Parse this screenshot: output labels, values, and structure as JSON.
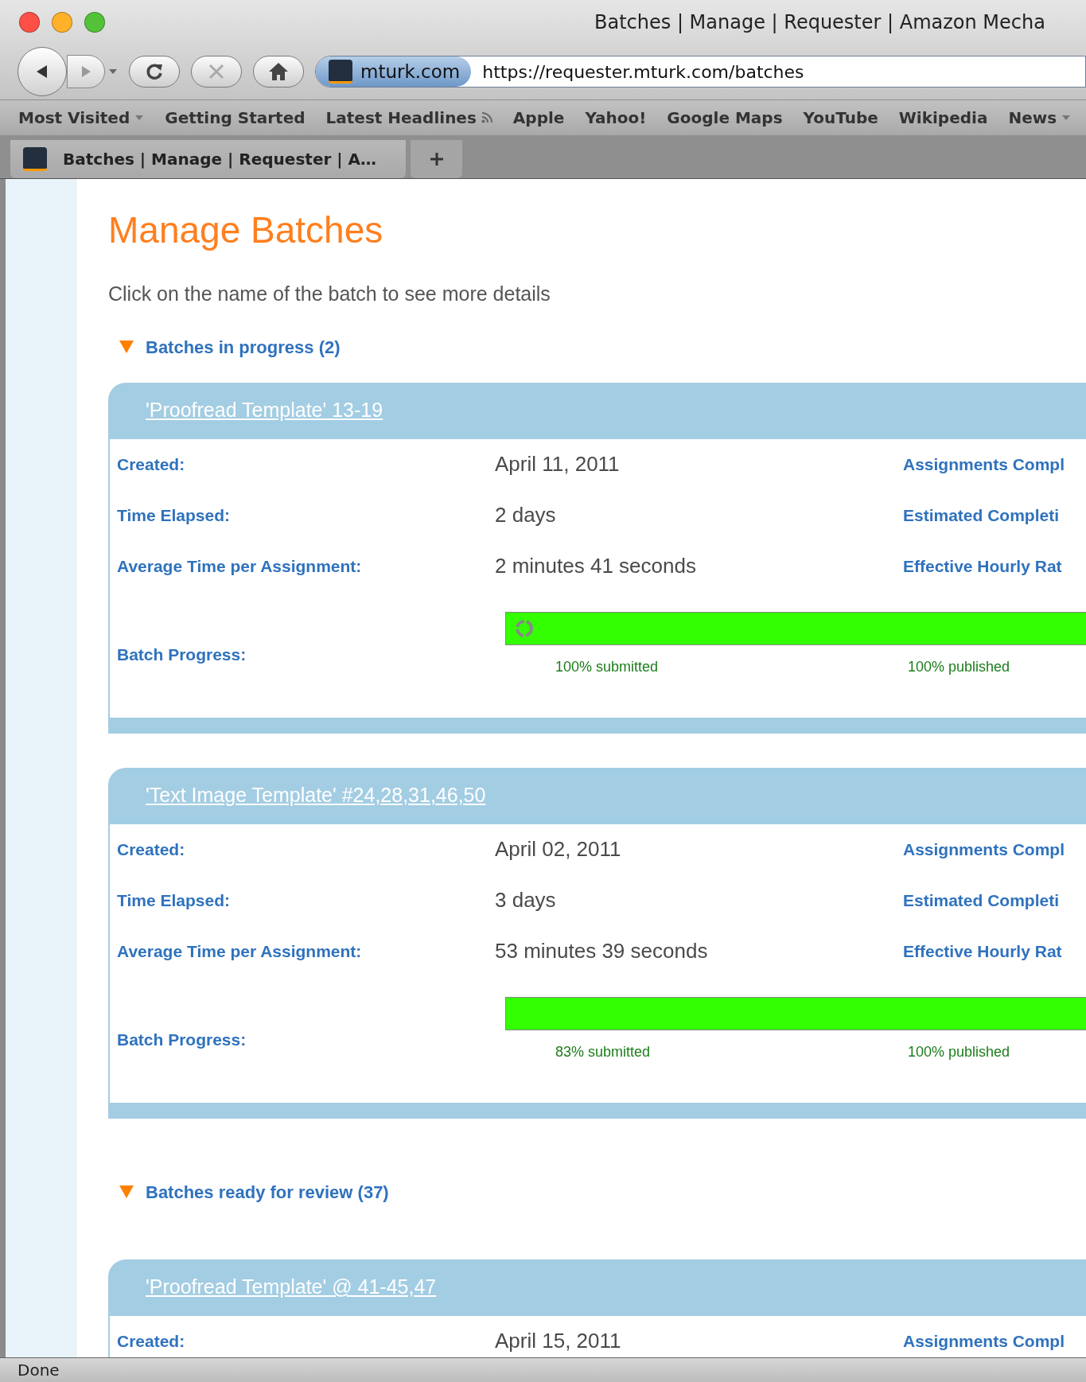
{
  "window": {
    "title": "Batches | Manage | Requester | Amazon Mecha"
  },
  "toolbar": {
    "site_identity": "mturk.com",
    "url": "https://requester.mturk.com/batches"
  },
  "bookmarks": [
    {
      "label": "Most Visited",
      "kind": "menu"
    },
    {
      "label": "Getting Started",
      "kind": "link"
    },
    {
      "label": "Latest Headlines",
      "kind": "feed"
    },
    {
      "label": "Apple",
      "kind": "link"
    },
    {
      "label": "Yahoo!",
      "kind": "link"
    },
    {
      "label": "Google Maps",
      "kind": "link"
    },
    {
      "label": "YouTube",
      "kind": "link"
    },
    {
      "label": "Wikipedia",
      "kind": "link"
    },
    {
      "label": "News",
      "kind": "menu"
    }
  ],
  "tabs": [
    {
      "label": "Batches | Manage | Requester | A…",
      "selected": true
    }
  ],
  "page": {
    "title": "Manage Batches",
    "intro": "Click on the name of the batch to see more details"
  },
  "sections": [
    {
      "heading": "Batches in progress (2)",
      "expanded": true,
      "batches": [
        {
          "name": "'Proofread Template' 13-19",
          "spinner": true,
          "rows": [
            {
              "label": "Created:",
              "value": "April 11, 2011",
              "right_label": "Assignments Compl"
            },
            {
              "label": "Time Elapsed:",
              "value": "2 days",
              "right_label": "Estimated Completi"
            },
            {
              "label": "Average Time per Assignment:",
              "value": "2 minutes 41 seconds",
              "right_label": "Effective Hourly Rat"
            }
          ],
          "progress": {
            "label": "Batch Progress:",
            "submitted": "100% submitted",
            "published": "100% published"
          }
        },
        {
          "name": "'Text Image Template' #24,28,31,46,50",
          "spinner": false,
          "rows": [
            {
              "label": "Created:",
              "value": "April 02, 2011",
              "right_label": "Assignments Compl"
            },
            {
              "label": "Time Elapsed:",
              "value": "3 days",
              "right_label": "Estimated Completi"
            },
            {
              "label": "Average Time per Assignment:",
              "value": "53 minutes 39 seconds",
              "right_label": "Effective Hourly Rat"
            }
          ],
          "progress": {
            "label": "Batch Progress:",
            "submitted": "83% submitted",
            "published": "100% published"
          }
        }
      ]
    },
    {
      "heading": "Batches ready for review (37)",
      "expanded": true,
      "batches": [
        {
          "name": "'Proofread Template' @ 41-45,47",
          "rows": [
            {
              "label": "Created:",
              "value": "April 15, 2011",
              "right_label": "Assignments Compl"
            }
          ]
        }
      ]
    }
  ],
  "status_bar": {
    "text": "Done"
  }
}
